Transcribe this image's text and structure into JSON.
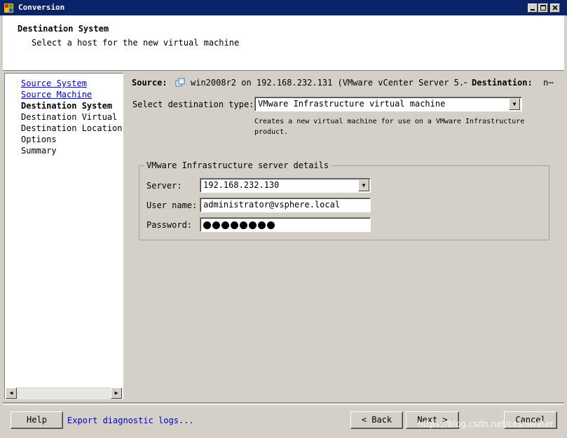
{
  "window": {
    "title": "Conversion"
  },
  "header": {
    "title": "Destination System",
    "subtitle": "Select a host for the new virtual machine"
  },
  "nav": {
    "items": [
      {
        "label": "Source System",
        "state": "link"
      },
      {
        "label": "Source Machine",
        "state": "link"
      },
      {
        "label": "Destination System",
        "state": "current"
      },
      {
        "label": "Destination Virtual Machine",
        "state": "plain"
      },
      {
        "label": "Destination Location",
        "state": "plain"
      },
      {
        "label": "Options",
        "state": "plain"
      },
      {
        "label": "Summary",
        "state": "plain"
      }
    ]
  },
  "summary_bar": {
    "source_label": "Source:",
    "source_value": "win2008r2 on 192.168.232.131 (VMware vCenter Server 5.⋯",
    "destination_label": "Destination:",
    "destination_value": "n⋯"
  },
  "destination_type": {
    "label": "Select destination type:",
    "value": "VMware Infrastructure virtual machine",
    "description": "Creates a new virtual machine for use on a VMware Infrastructure product."
  },
  "server_details": {
    "title": "VMware Infrastructure server details",
    "server_label": "Server:",
    "server_value": "192.168.232.130",
    "username_label": "User name:",
    "username_value": "administrator@vsphere.local",
    "password_label": "Password:",
    "password_mask_count": 8
  },
  "footer": {
    "help_label": "Help",
    "export_logs_label": "Export diagnostic logs...",
    "back_label": "< Back",
    "next_label": "Next >",
    "cancel_label": "Cancel"
  },
  "watermark": "https://blog.csdn.net/ceshiwater",
  "colors": {
    "titlebar": "#0a246a",
    "link": "#0000cc",
    "face": "#d4d0c8"
  }
}
